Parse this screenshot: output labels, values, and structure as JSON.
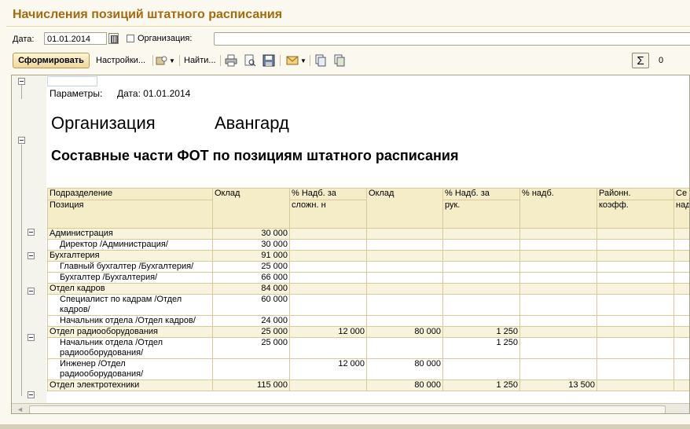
{
  "window": {
    "title": "Начисления позиций штатного расписания"
  },
  "filters": {
    "date_label": "Дата:",
    "date_value": "01.01.2014",
    "org_label": "Организация:",
    "org_value": ""
  },
  "toolbar": {
    "generate": "Сформировать",
    "settings": "Настройки...",
    "find": "Найти...",
    "sum_value": "0"
  },
  "report": {
    "params_label": "Параметры:",
    "params_value": "Дата: 01.01.2014",
    "org_label": "Организация",
    "org_value": "Авангард",
    "title": "Составные части ФОТ по позициям штатного расписания",
    "headers": {
      "c1a": "Подразделение",
      "c1b": "Позиция",
      "c2": "Оклад",
      "c3a": "%  Надб. за",
      "c3b": "сложн. н",
      "c4": "Оклад",
      "c5a": "%  Надб. за",
      "c5b": "рук.",
      "c6": "% надб.",
      "c7a": "Районн.",
      "c7b": "коэфф.",
      "c8a": "Се",
      "c8b": "над"
    },
    "rows": [
      {
        "type": "grp",
        "c1": "Администрация",
        "c2": "30 000",
        "c3": "",
        "c4": "",
        "c5": "",
        "c6": "",
        "c7": "",
        "c8": ""
      },
      {
        "type": "item",
        "c1": "Директор /Администрация/",
        "c2": "30 000",
        "c3": "",
        "c4": "",
        "c5": "",
        "c6": "",
        "c7": "",
        "c8": ""
      },
      {
        "type": "grp",
        "c1": "Бухгалтерия",
        "c2": "91 000",
        "c3": "",
        "c4": "",
        "c5": "",
        "c6": "",
        "c7": "",
        "c8": ""
      },
      {
        "type": "item",
        "c1": "Главный бухгалтер /Бухгалтерия/",
        "c2": "25 000",
        "c3": "",
        "c4": "",
        "c5": "",
        "c6": "",
        "c7": "",
        "c8": ""
      },
      {
        "type": "item",
        "c1": "Бухгалтер /Бухгалтерия/",
        "c2": "66 000",
        "c3": "",
        "c4": "",
        "c5": "",
        "c6": "",
        "c7": "",
        "c8": ""
      },
      {
        "type": "grp",
        "c1": "Отдел кадров",
        "c2": "84 000",
        "c3": "",
        "c4": "",
        "c5": "",
        "c6": "",
        "c7": "",
        "c8": ""
      },
      {
        "type": "item",
        "c1": "Специалист по кадрам /Отдел кадров/",
        "c2": "60 000",
        "c3": "",
        "c4": "",
        "c5": "",
        "c6": "",
        "c7": "",
        "c8": ""
      },
      {
        "type": "item",
        "c1": "Начальник отдела /Отдел кадров/",
        "c2": "24 000",
        "c3": "",
        "c4": "",
        "c5": "",
        "c6": "",
        "c7": "",
        "c8": ""
      },
      {
        "type": "grp",
        "c1": "Отдел радиооборудования",
        "c2": "25 000",
        "c3": "12 000",
        "c4": "80 000",
        "c5": "1 250",
        "c6": "",
        "c7": "",
        "c8": ""
      },
      {
        "type": "item",
        "c1": "Начальник отдела /Отдел радиооборудования/",
        "c2": "25 000",
        "c3": "",
        "c4": "",
        "c5": "1 250",
        "c6": "",
        "c7": "",
        "c8": ""
      },
      {
        "type": "item",
        "c1": "Инженер /Отдел радиооборудования/",
        "c2": "",
        "c3": "12 000",
        "c4": "80 000",
        "c5": "",
        "c6": "",
        "c7": "",
        "c8": ""
      },
      {
        "type": "grp",
        "c1": "Отдел электротехники",
        "c2": "115 000",
        "c3": "",
        "c4": "80 000",
        "c5": "1 250",
        "c6": "13 500",
        "c7": "",
        "c8": ""
      }
    ]
  }
}
